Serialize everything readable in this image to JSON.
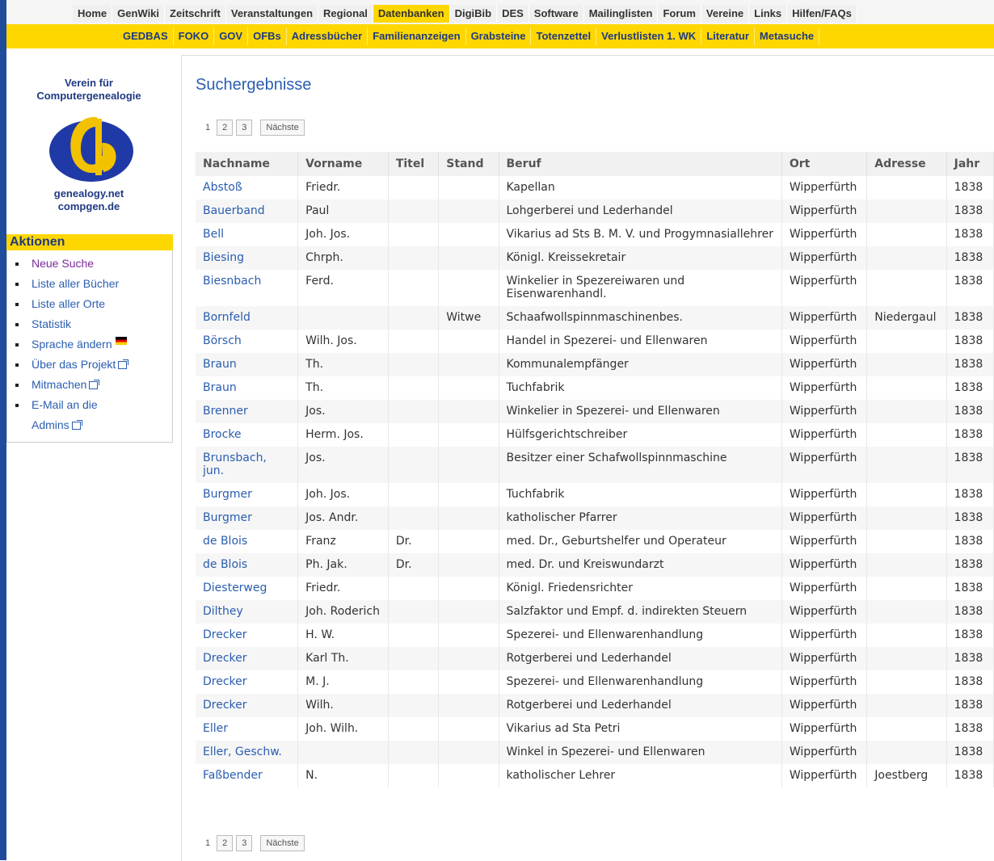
{
  "nav_top": [
    "Home",
    "GenWiki",
    "Zeitschrift",
    "Veranstaltungen",
    "Regional",
    "Datenbanken",
    "DigiBib",
    "DES",
    "Software",
    "Mailinglisten",
    "Forum",
    "Vereine",
    "Links",
    "Hilfen/FAQs"
  ],
  "nav_sub": [
    "GEDBAS",
    "FOKO",
    "GOV",
    "OFBs",
    "Adressbücher",
    "Familienanzeigen",
    "Grabsteine",
    "Totenzettel",
    "Verlustlisten 1. WK",
    "Literatur",
    "Metasuche"
  ],
  "sidebar": {
    "org_line1": "Verein für",
    "org_line2": "Computergenealogie",
    "domain1": "genealogy.net",
    "domain2": "compgen.de",
    "actions_title": "Aktionen",
    "actions": [
      "Neue Suche",
      "Liste aller Bücher",
      "Liste aller Orte",
      "Statistik",
      "Sprache ändern",
      "Über das Projekt",
      "Mitmachen",
      "E-Mail an die",
      "Admins"
    ]
  },
  "main": {
    "title": "Suchergebnisse",
    "pager": {
      "current": "1",
      "pages": [
        "2",
        "3"
      ],
      "next": "Nächste"
    },
    "columns": [
      "Nachname",
      "Vorname",
      "Titel",
      "Stand",
      "Beruf",
      "Ort",
      "Adresse",
      "Jahr"
    ],
    "rows": [
      [
        "Abstoß",
        "Friedr.",
        "",
        "",
        "Kapellan",
        "Wipperfürth",
        "",
        "1838"
      ],
      [
        "Bauerband",
        "Paul",
        "",
        "",
        "Lohgerberei und Lederhandel",
        "Wipperfürth",
        "",
        "1838"
      ],
      [
        "Bell",
        "Joh. Jos.",
        "",
        "",
        "Vikarius ad Sts B. M. V. und Progymnasiallehrer",
        "Wipperfürth",
        "",
        "1838"
      ],
      [
        "Biesing",
        "Chrph.",
        "",
        "",
        "Königl. Kreissekretair",
        "Wipperfürth",
        "",
        "1838"
      ],
      [
        "Biesnbach",
        "Ferd.",
        "",
        "",
        "Winkelier in Spezereiwaren und Eisenwarenhandl.",
        "Wipperfürth",
        "",
        "1838"
      ],
      [
        "Bornfeld",
        "",
        "",
        "Witwe",
        "Schaafwollspinnmaschinenbes.",
        "Wipperfürth",
        "Niedergaul",
        "1838"
      ],
      [
        "Börsch",
        "Wilh. Jos.",
        "",
        "",
        "Handel in Spezerei- und Ellenwaren",
        "Wipperfürth",
        "",
        "1838"
      ],
      [
        "Braun",
        "Th.",
        "",
        "",
        "Kommunalempfänger",
        "Wipperfürth",
        "",
        "1838"
      ],
      [
        "Braun",
        "Th.",
        "",
        "",
        "Tuchfabrik",
        "Wipperfürth",
        "",
        "1838"
      ],
      [
        "Brenner",
        "Jos.",
        "",
        "",
        "Winkelier in Spezerei- und Ellenwaren",
        "Wipperfürth",
        "",
        "1838"
      ],
      [
        "Brocke",
        "Herm. Jos.",
        "",
        "",
        "Hülfsgerichtschreiber",
        "Wipperfürth",
        "",
        "1838"
      ],
      [
        "Brunsbach, jun.",
        "Jos.",
        "",
        "",
        "Besitzer einer Schafwollspinnmaschine",
        "Wipperfürth",
        "",
        "1838"
      ],
      [
        "Burgmer",
        "Joh. Jos.",
        "",
        "",
        "Tuchfabrik",
        "Wipperfürth",
        "",
        "1838"
      ],
      [
        "Burgmer",
        "Jos. Andr.",
        "",
        "",
        "katholischer Pfarrer",
        "Wipperfürth",
        "",
        "1838"
      ],
      [
        "de Blois",
        "Franz",
        "Dr.",
        "",
        "med. Dr., Geburtshelfer und Operateur",
        "Wipperfürth",
        "",
        "1838"
      ],
      [
        "de Blois",
        "Ph. Jak.",
        "Dr.",
        "",
        "med. Dr. und Kreiswundarzt",
        "Wipperfürth",
        "",
        "1838"
      ],
      [
        "Diesterweg",
        "Friedr.",
        "",
        "",
        "Königl. Friedensrichter",
        "Wipperfürth",
        "",
        "1838"
      ],
      [
        "Dilthey",
        "Joh. Roderich",
        "",
        "",
        "Salzfaktor und Empf. d. indirekten Steuern",
        "Wipperfürth",
        "",
        "1838"
      ],
      [
        "Drecker",
        "H. W.",
        "",
        "",
        "Spezerei- und Ellenwarenhandlung",
        "Wipperfürth",
        "",
        "1838"
      ],
      [
        "Drecker",
        "Karl Th.",
        "",
        "",
        "Rotgerberei und Lederhandel",
        "Wipperfürth",
        "",
        "1838"
      ],
      [
        "Drecker",
        "M. J.",
        "",
        "",
        "Spezerei- und Ellenwarenhandlung",
        "Wipperfürth",
        "",
        "1838"
      ],
      [
        "Drecker",
        "Wilh.",
        "",
        "",
        "Rotgerberei und Lederhandel",
        "Wipperfürth",
        "",
        "1838"
      ],
      [
        "Eller",
        "Joh. Wilh.",
        "",
        "",
        "Vikarius ad Sta Petri",
        "Wipperfürth",
        "",
        "1838"
      ],
      [
        "Eller, Geschw.",
        "",
        "",
        "",
        "Winkel in Spezerei- und Ellenwaren",
        "Wipperfürth",
        "",
        "1838"
      ],
      [
        "Faßbender",
        "N.",
        "",
        "",
        "katholischer Lehrer",
        "Wipperfürth",
        "Joestberg",
        "1838"
      ]
    ]
  },
  "colors": {
    "accent_yellow": "#ffd700",
    "link_blue": "#2a5db0",
    "border_blue": "#1f4d9a"
  }
}
